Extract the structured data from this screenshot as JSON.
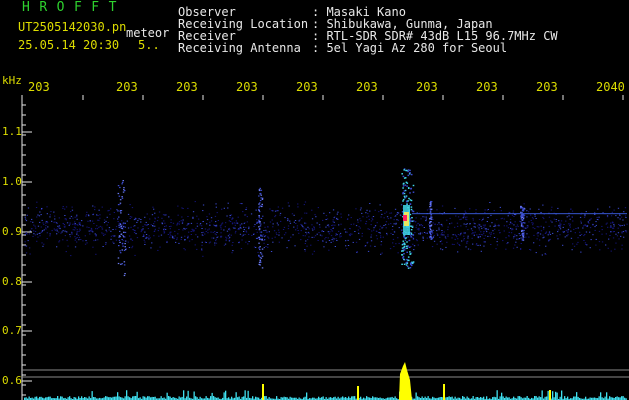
{
  "logo": "HROFFT",
  "file_name": "UT2505142030.pn",
  "meteor_label": "meteor",
  "date_time": "25.05.14 20:30",
  "interval": "5..",
  "info": [
    {
      "label": "Observer",
      "value": ": Masaki Kano"
    },
    {
      "label": "Receiving Location",
      "value": ": Shibukawa, Gunma, Japan"
    },
    {
      "label": "Receiver",
      "value": ": RTL-SDR SDR# 43dB L15 96.7MHz CW"
    },
    {
      "label": "Receiving Antenna",
      "value": ": 5el Yagi Az 280 for Seoul"
    }
  ],
  "axis": {
    "y_unit": "kHz",
    "x_ticks": [
      "203",
      "203",
      "203",
      "203",
      "203",
      "203",
      "203",
      "203",
      "203",
      "2040"
    ],
    "y_ticks": [
      "1.1",
      "1.0",
      "0.9",
      "0.8",
      "0.7",
      "0.6"
    ]
  },
  "colors": {
    "background": "#000000",
    "axis_text": "#dddd00",
    "logo": "#2ed12e",
    "noise_dark": "#14147a",
    "noise_light": "#3a4ad0",
    "signal_cyan": "#40d8e8",
    "signal_hot": "#ff2060",
    "bottom_meter": "#40e0f0",
    "meteor_peak": "#ffff00"
  }
}
